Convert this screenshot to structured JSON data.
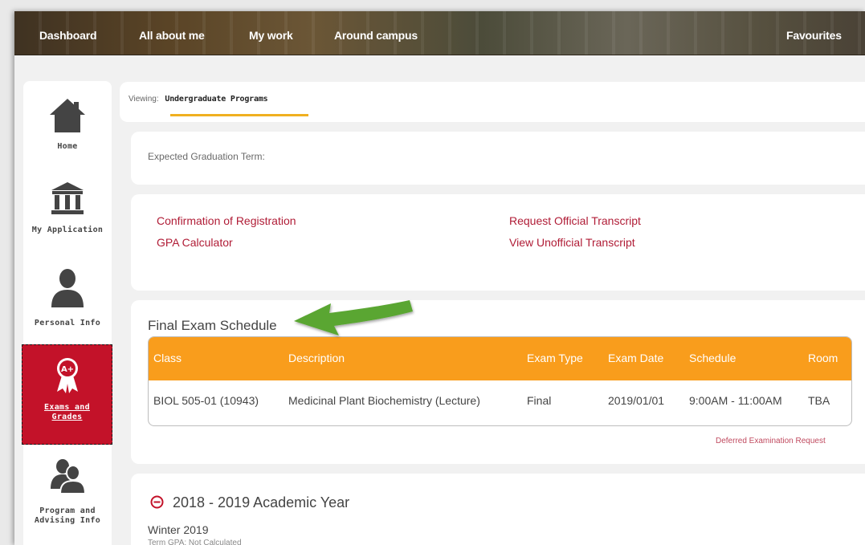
{
  "nav": {
    "items": [
      "Dashboard",
      "All about me",
      "My work",
      "Around campus"
    ],
    "right": "Favourites"
  },
  "sidebar": {
    "items": [
      {
        "label": "Home",
        "icon": "home-icon"
      },
      {
        "label": "My Application",
        "icon": "building-icon"
      },
      {
        "label": "Personal Info",
        "icon": "person-icon"
      },
      {
        "label_line1": "Exams and",
        "label_line2": "Grades",
        "icon": "award-ribbon-icon",
        "badge": "A+",
        "active": true
      },
      {
        "label_line1": "Program and",
        "label_line2": "Advising Info",
        "icon": "people-icon"
      }
    ],
    "active_color": "#c31229"
  },
  "viewing": {
    "prefix": "Viewing:",
    "program": "Undergraduate Programs"
  },
  "graduation": {
    "label": "Expected Graduation Term:"
  },
  "links": {
    "confirmation": "Confirmation of Registration",
    "gpa": "GPA Calculator",
    "request_transcript": "Request Official Transcript",
    "unofficial_transcript": "View Unofficial Transcript"
  },
  "exam": {
    "title": "Final Exam Schedule",
    "columns": [
      "Class",
      "Description",
      "Exam Type",
      "Exam Date",
      "Schedule",
      "Room"
    ],
    "rows": [
      [
        "BIOL 505-01 (10943)",
        "Medicinal Plant Biochemistry (Lecture)",
        "Final",
        "2019/01/01",
        "9:00AM - 11:00AM",
        "TBA"
      ]
    ],
    "deferred_link": "Deferred Examination Request",
    "header_color": "#f99d1c"
  },
  "academic": {
    "year_title": "2018 - 2019 Academic Year",
    "term": "Winter 2019",
    "term_gpa": "Term GPA: Not Calculated"
  },
  "colors": {
    "link": "#b01c36",
    "accent": "#f0b020",
    "arrow": "#5aa631"
  }
}
